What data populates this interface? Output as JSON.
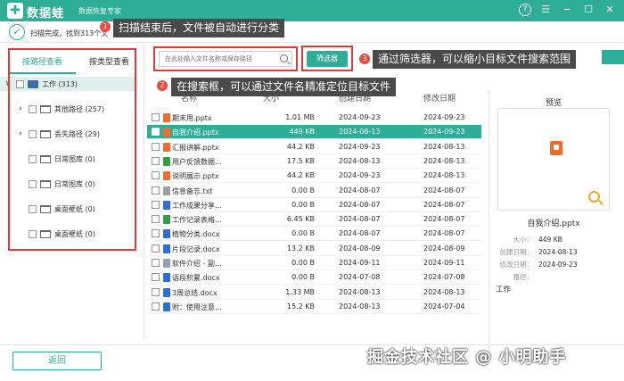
{
  "app": {
    "logo_symbol": "✚",
    "name": "数据蛙",
    "subtitle": "数据恢复专家",
    "accent": "#2eae96"
  },
  "window_controls": {
    "help": "?",
    "menu": "☰",
    "minimize": "−",
    "maximize": "☐",
    "close": "✕"
  },
  "status": {
    "check": "✓",
    "text": "扫描完成，找到313个文"
  },
  "callouts": {
    "c1": {
      "num": "1",
      "text": "扫描结束后，文件被自动进行分类"
    },
    "c2": {
      "num": "2",
      "text": "在搜索框，可以通过文件名精准定位目标文件"
    },
    "c3": {
      "num": "3",
      "text": "通过筛选器，可以缩小目标文件搜索范围"
    }
  },
  "sidebar": {
    "tabs": [
      "按路径查看",
      "按类型查看"
    ],
    "root": {
      "label": "工作 (313)",
      "chevron": "∨"
    },
    "items": [
      {
        "label": "其他路径 (257)",
        "chevron": "›"
      },
      {
        "label": "丢失路径 (29)",
        "chevron": "›"
      },
      {
        "label": "日常图库 (0)"
      },
      {
        "label": "日常图库 (0)"
      },
      {
        "label": "桌面壁纸 (0)"
      },
      {
        "label": "桌面壁纸 (0)"
      }
    ]
  },
  "search": {
    "placeholder": "在此处输入文件名称或保存路径"
  },
  "filter": {
    "label": "筛选器"
  },
  "table": {
    "columns": [
      "名称",
      "大小",
      "创建日期",
      "修改日期"
    ],
    "rows": [
      {
        "name": "期末用.pptx",
        "size": "1.01 MB",
        "created": "2024-09-23",
        "modified": "2024-09-23",
        "icon": "#f26b2b"
      },
      {
        "name": "自我介绍.pptx",
        "size": "449 KB",
        "created": "2024-08-13",
        "modified": "2024-09-23",
        "icon": "#f26b2b"
      },
      {
        "name": "汇报讲解.pptx",
        "size": "44.2 KB",
        "created": "2024-09-23",
        "modified": "2024-08-13",
        "icon": "#f26b2b"
      },
      {
        "name": "用户反馈数据...",
        "size": "17.5 KB",
        "created": "2024-08-13",
        "modified": "2024-08-13",
        "icon": "#2f9e44"
      },
      {
        "name": "说明展示.pptx",
        "size": "44.2 KB",
        "created": "2024-09-23",
        "modified": "2024-08-13",
        "icon": "#f26b2b"
      },
      {
        "name": "信息备忘.txt",
        "size": "0.00 B",
        "created": "2024-08-07",
        "modified": "2024-08-07",
        "icon": "#9aa0a6"
      },
      {
        "name": "工作成果分享...",
        "size": "0.00 B",
        "created": "2024-08-07",
        "modified": "2024-08-07",
        "icon": "#2b6fd6"
      },
      {
        "name": "工作记录表格...",
        "size": "6.45 KB",
        "created": "2024-08-07",
        "modified": "2024-08-07",
        "icon": "#2f9e44"
      },
      {
        "name": "植物分类.docx",
        "size": "0.00 B",
        "created": "2024-08-07",
        "modified": "2024-08-07",
        "icon": "#2b6fd6"
      },
      {
        "name": "片段记录.docx",
        "size": "13.2 KB",
        "created": "2024-08-09",
        "modified": "2024-08-09",
        "icon": "#2b6fd6"
      },
      {
        "name": "软件介绍 - 副...",
        "size": "0.00 B",
        "created": "2024-09-11",
        "modified": "2024-09-11",
        "icon": "#9aa0a6"
      },
      {
        "name": "语段积累.docx",
        "size": "0.00 B",
        "created": "2024-07-08",
        "modified": "2024-07-08",
        "icon": "#2b6fd6"
      },
      {
        "name": "3周总结.docx",
        "size": "1.33 MB",
        "created": "2024-08-13",
        "modified": "2024-08-13",
        "icon": "#2b6fd6"
      },
      {
        "name": "附：使用注意...",
        "size": "15.2 KB",
        "created": "2024-08-13",
        "modified": "2024-07-04",
        "icon": "#2b6fd6"
      }
    ],
    "selected_index": 1
  },
  "preview": {
    "title": "预览",
    "filename": "自我介绍.pptx",
    "meta": [
      {
        "key": "大小：",
        "value": "449 KB"
      },
      {
        "key": "创建日期：",
        "value": "2024-08-13"
      },
      {
        "key": "修改日期：",
        "value": "2024-09-23"
      },
      {
        "key": "路径：",
        "value": ""
      }
    ],
    "path": "工作"
  },
  "back_button": "返回",
  "watermark": "掘金技术社区 @ 小明助手"
}
